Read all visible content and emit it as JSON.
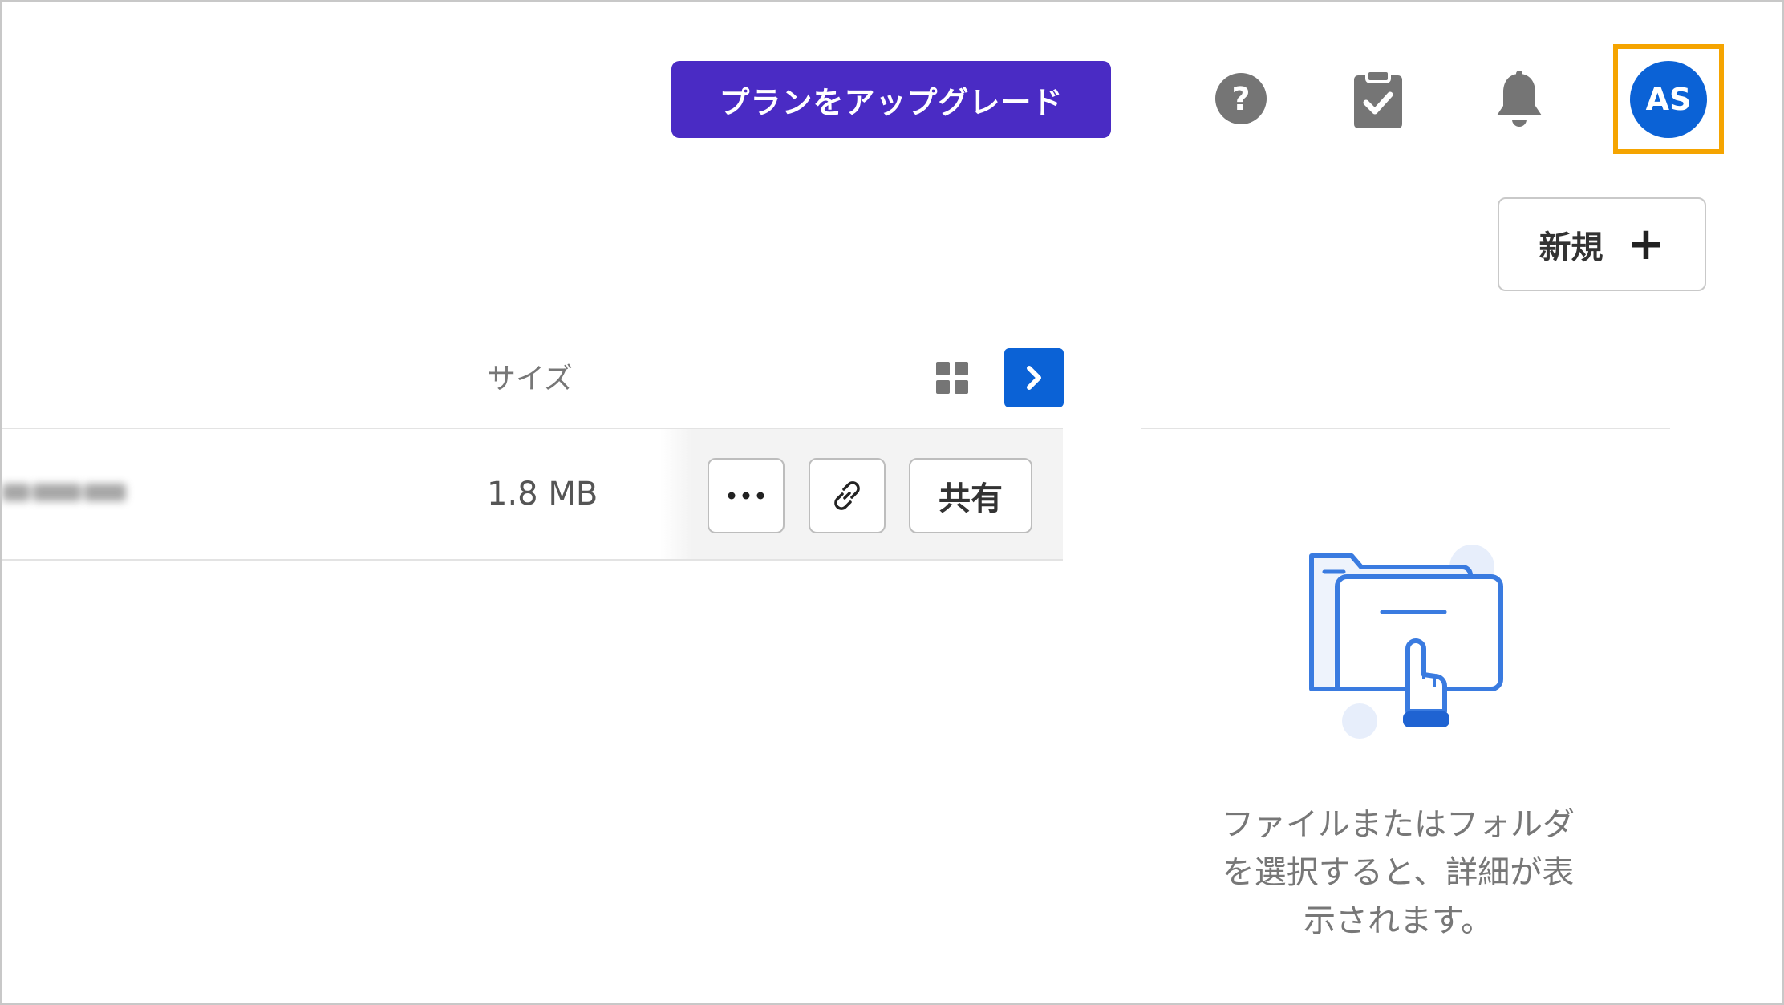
{
  "header": {
    "upgrade_label": "プランをアップグレード",
    "help_icon": "help-circle-icon",
    "tasks_icon": "clipboard-check-icon",
    "notifications_icon": "bell-icon",
    "avatar_initials": "AS"
  },
  "toolbar": {
    "new_label": "新規",
    "new_icon": "plus-icon"
  },
  "table": {
    "columns": {
      "size": "サイズ"
    },
    "view_toggle_icon": "grid-view-icon",
    "panel_toggle_icon": "chevron-right-icon",
    "rows": [
      {
        "name": "",
        "size": "1.8 MB",
        "actions": {
          "more_icon": "more-horizontal-icon",
          "link_icon": "link-icon",
          "share_label": "共有"
        }
      }
    ]
  },
  "details_panel": {
    "empty_message": "ファイルまたはフォルダを選択すると、詳細が表示されます。",
    "illustration_icon": "folder-touch-icon"
  },
  "colors": {
    "upgrade_bg": "#4a2bc4",
    "accent_blue": "#0b62d6",
    "highlight": "#f5a400",
    "icon_gray": "#757575"
  }
}
